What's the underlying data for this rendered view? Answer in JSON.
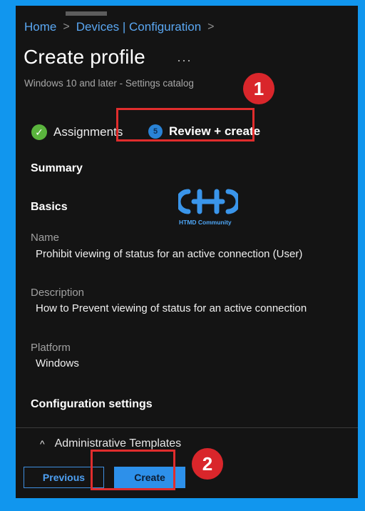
{
  "breadcrumb": {
    "home": "Home",
    "sep1": ">",
    "devices": "Devices | Configuration",
    "sep2": ">"
  },
  "header": {
    "title": "Create profile",
    "more": "···",
    "subtitle": "Windows 10 and later - Settings catalog"
  },
  "steps": [
    {
      "label": "Assignments",
      "status": "completed",
      "icon": "check-circle-icon",
      "mark": "✓"
    },
    {
      "label": "Review + create",
      "status": "current",
      "number": "5"
    }
  ],
  "callouts": [
    "1",
    "2"
  ],
  "summary": {
    "heading": "Summary",
    "basics_heading": "Basics",
    "name_label": "Name",
    "name_value": "Prohibit viewing of status for an active connection (User)",
    "description_label": "Description",
    "description_value": "How to Prevent viewing of status for an active connection",
    "platform_label": "Platform",
    "platform_value": "Windows",
    "config_heading": "Configuration settings",
    "admin_templates": "Administrative Templates",
    "admin_caret": "^"
  },
  "watermark": {
    "text": "HTMD Community"
  },
  "footer": {
    "previous_label": "Previous",
    "create_label": "Create"
  },
  "colors": {
    "accent": "#2d90ea",
    "frame": "#1196ee",
    "callout": "#d9262b",
    "success": "#5ab43d",
    "background": "#141414"
  }
}
